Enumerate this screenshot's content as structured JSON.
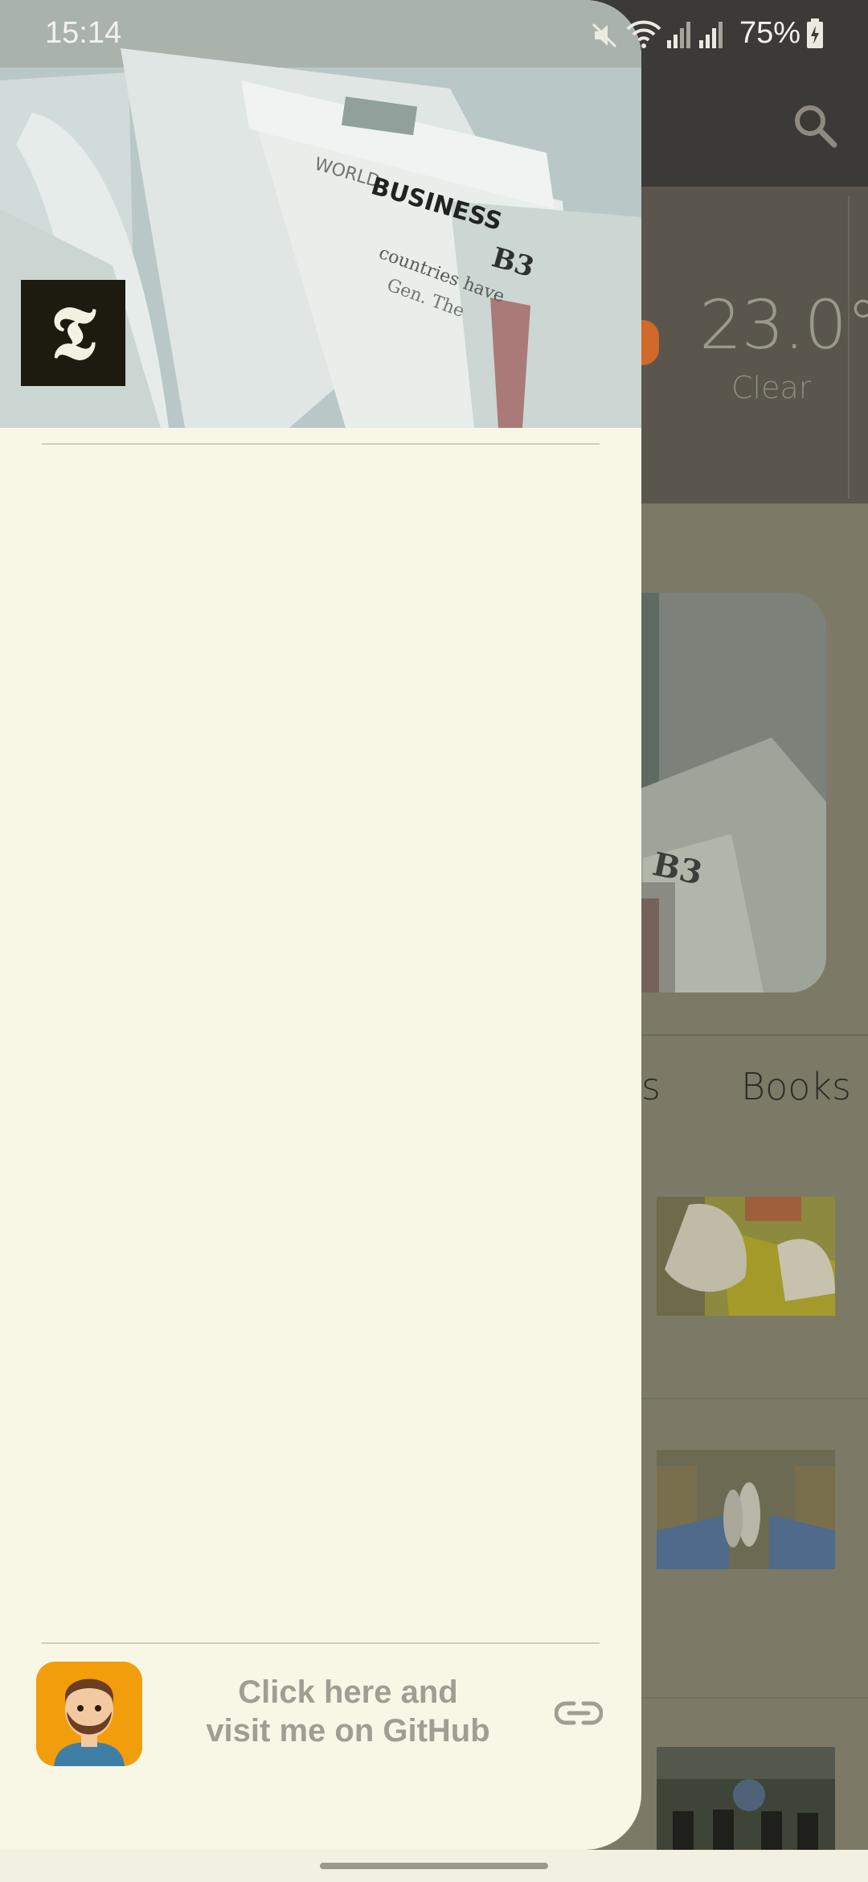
{
  "status_bar": {
    "time": "15:14",
    "battery": "75%",
    "icons": [
      "mute-icon",
      "wifi-icon",
      "signal-icon",
      "signal-icon",
      "battery-charging-icon"
    ]
  },
  "app_bar": {
    "search_icon": "search-icon"
  },
  "weather": {
    "temperature": "23.0°",
    "condition": "Clear"
  },
  "tabs": {
    "partial": "ts",
    "books": "Books"
  },
  "drawer": {
    "header_image": "newspapers-stack",
    "header_paper_text": [
      "WORLD",
      "BUSINESS",
      "B3",
      "countries have",
      "Gen. The"
    ],
    "logo_letter": "𝕿",
    "footer": {
      "github_line1": "Click here and",
      "github_line2": "visit me on GitHub",
      "avatar_icon": "bearded-man-avatar-icon",
      "link_icon": "link-icon"
    }
  },
  "colors": {
    "drawer_bg": "#f8f7e6",
    "app_bar": "#3b3a37",
    "weather_panel": "#5a564e",
    "avatar_bg": "#f29e0c"
  }
}
